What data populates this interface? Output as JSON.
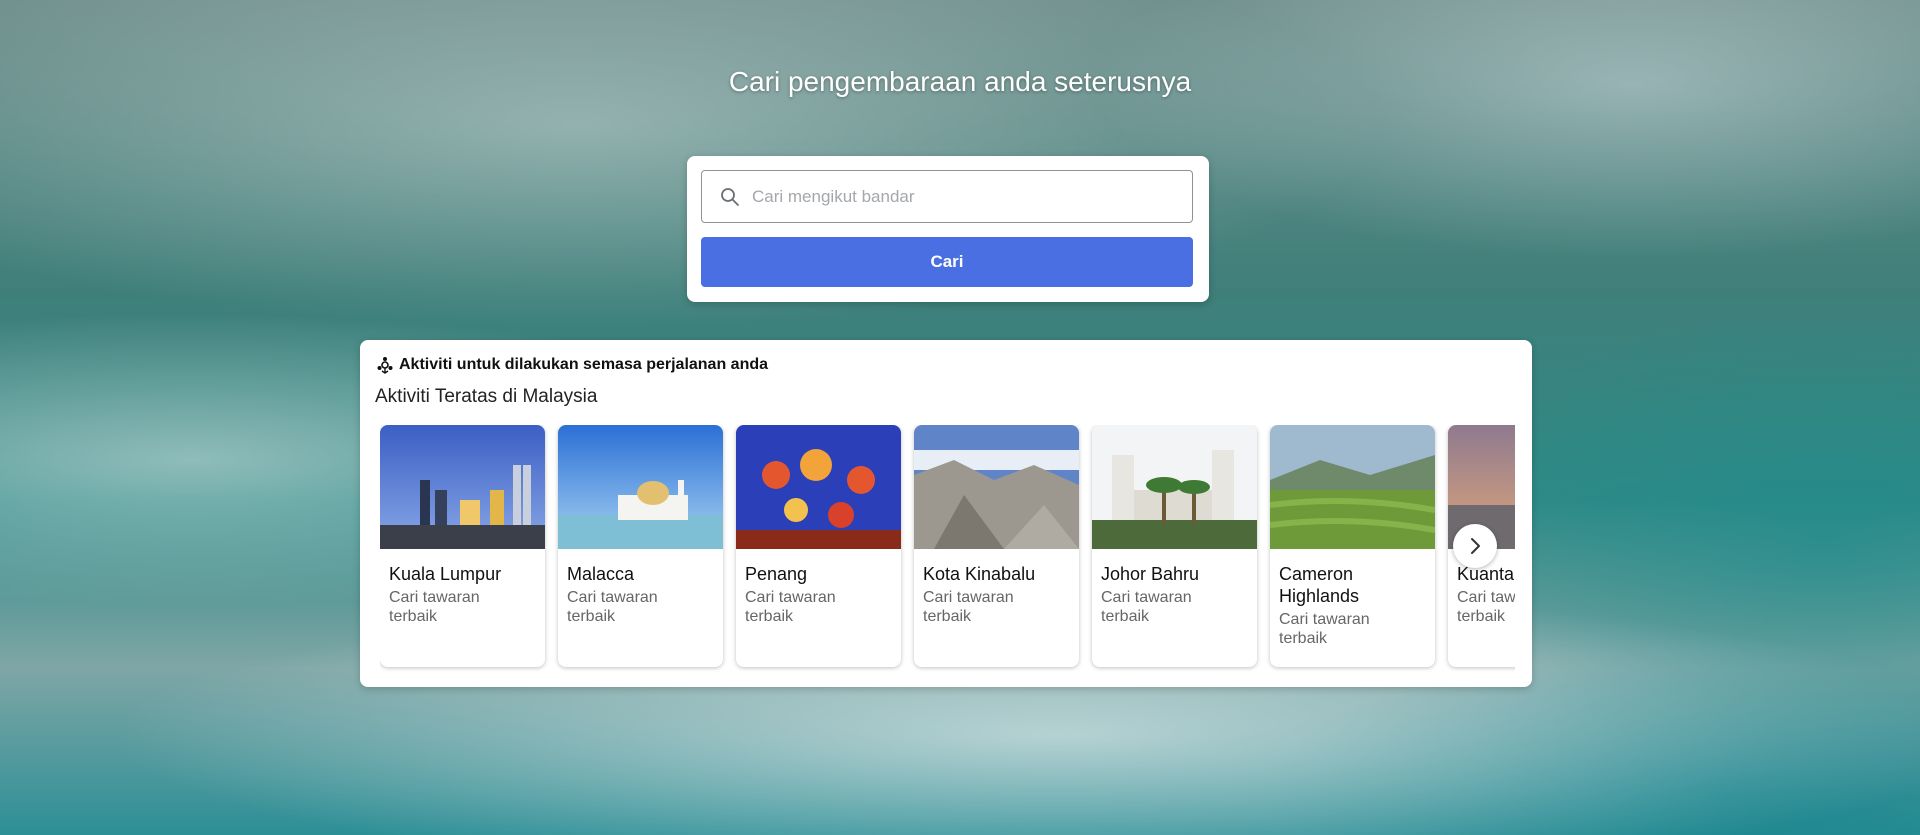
{
  "hero": {
    "title": "Cari pengembaraan anda seterusnya"
  },
  "search": {
    "placeholder": "Cari mengikut bandar",
    "value": "",
    "button_label": "Cari",
    "accent_color": "#4a6fe3",
    "icon": "search-icon"
  },
  "activities": {
    "icon": "activities-icon",
    "heading": "Aktiviti untuk dilakukan semasa perjalanan anda",
    "subtitle": "Aktiviti Teratas di Malaysia",
    "next_icon": "chevron-right-icon",
    "cities": [
      {
        "name": "Kuala Lumpur",
        "desc": "Cari tawaran terbaik"
      },
      {
        "name": "Malacca",
        "desc": "Cari tawaran terbaik"
      },
      {
        "name": "Penang",
        "desc": "Cari tawaran terbaik"
      },
      {
        "name": "Kota Kinabalu",
        "desc": "Cari tawaran terbaik"
      },
      {
        "name": "Johor Bahru",
        "desc": "Cari tawaran terbaik"
      },
      {
        "name": "Cameron Highlands",
        "desc": "Cari tawaran terbaik"
      },
      {
        "name": "Kuantan",
        "desc": "Cari tawaran terbaik"
      }
    ]
  }
}
